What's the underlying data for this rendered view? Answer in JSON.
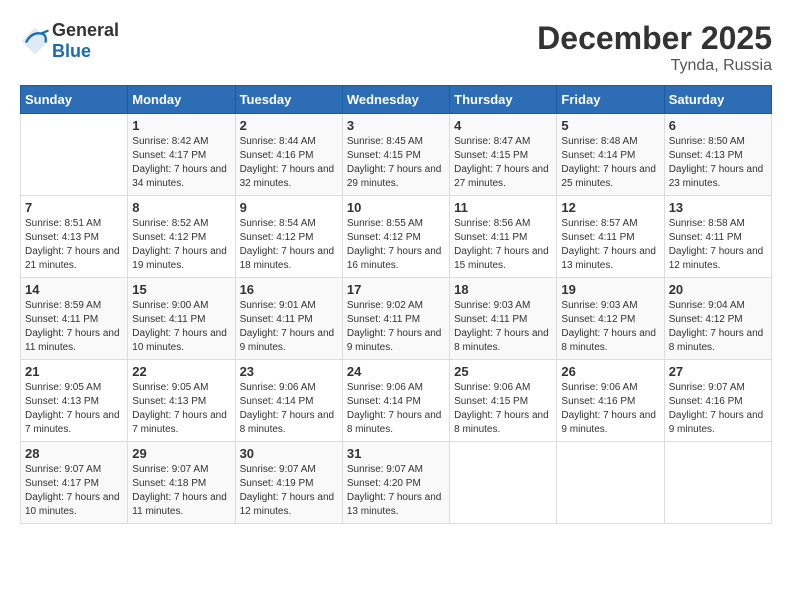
{
  "header": {
    "logo_general": "General",
    "logo_blue": "Blue",
    "month": "December 2025",
    "location": "Tynda, Russia"
  },
  "weekdays": [
    "Sunday",
    "Monday",
    "Tuesday",
    "Wednesday",
    "Thursday",
    "Friday",
    "Saturday"
  ],
  "weeks": [
    [
      {
        "day": "",
        "sunrise": "",
        "sunset": "",
        "daylight": ""
      },
      {
        "day": "1",
        "sunrise": "Sunrise: 8:42 AM",
        "sunset": "Sunset: 4:17 PM",
        "daylight": "Daylight: 7 hours and 34 minutes."
      },
      {
        "day": "2",
        "sunrise": "Sunrise: 8:44 AM",
        "sunset": "Sunset: 4:16 PM",
        "daylight": "Daylight: 7 hours and 32 minutes."
      },
      {
        "day": "3",
        "sunrise": "Sunrise: 8:45 AM",
        "sunset": "Sunset: 4:15 PM",
        "daylight": "Daylight: 7 hours and 29 minutes."
      },
      {
        "day": "4",
        "sunrise": "Sunrise: 8:47 AM",
        "sunset": "Sunset: 4:15 PM",
        "daylight": "Daylight: 7 hours and 27 minutes."
      },
      {
        "day": "5",
        "sunrise": "Sunrise: 8:48 AM",
        "sunset": "Sunset: 4:14 PM",
        "daylight": "Daylight: 7 hours and 25 minutes."
      },
      {
        "day": "6",
        "sunrise": "Sunrise: 8:50 AM",
        "sunset": "Sunset: 4:13 PM",
        "daylight": "Daylight: 7 hours and 23 minutes."
      }
    ],
    [
      {
        "day": "7",
        "sunrise": "Sunrise: 8:51 AM",
        "sunset": "Sunset: 4:13 PM",
        "daylight": "Daylight: 7 hours and 21 minutes."
      },
      {
        "day": "8",
        "sunrise": "Sunrise: 8:52 AM",
        "sunset": "Sunset: 4:12 PM",
        "daylight": "Daylight: 7 hours and 19 minutes."
      },
      {
        "day": "9",
        "sunrise": "Sunrise: 8:54 AM",
        "sunset": "Sunset: 4:12 PM",
        "daylight": "Daylight: 7 hours and 18 minutes."
      },
      {
        "day": "10",
        "sunrise": "Sunrise: 8:55 AM",
        "sunset": "Sunset: 4:12 PM",
        "daylight": "Daylight: 7 hours and 16 minutes."
      },
      {
        "day": "11",
        "sunrise": "Sunrise: 8:56 AM",
        "sunset": "Sunset: 4:11 PM",
        "daylight": "Daylight: 7 hours and 15 minutes."
      },
      {
        "day": "12",
        "sunrise": "Sunrise: 8:57 AM",
        "sunset": "Sunset: 4:11 PM",
        "daylight": "Daylight: 7 hours and 13 minutes."
      },
      {
        "day": "13",
        "sunrise": "Sunrise: 8:58 AM",
        "sunset": "Sunset: 4:11 PM",
        "daylight": "Daylight: 7 hours and 12 minutes."
      }
    ],
    [
      {
        "day": "14",
        "sunrise": "Sunrise: 8:59 AM",
        "sunset": "Sunset: 4:11 PM",
        "daylight": "Daylight: 7 hours and 11 minutes."
      },
      {
        "day": "15",
        "sunrise": "Sunrise: 9:00 AM",
        "sunset": "Sunset: 4:11 PM",
        "daylight": "Daylight: 7 hours and 10 minutes."
      },
      {
        "day": "16",
        "sunrise": "Sunrise: 9:01 AM",
        "sunset": "Sunset: 4:11 PM",
        "daylight": "Daylight: 7 hours and 9 minutes."
      },
      {
        "day": "17",
        "sunrise": "Sunrise: 9:02 AM",
        "sunset": "Sunset: 4:11 PM",
        "daylight": "Daylight: 7 hours and 9 minutes."
      },
      {
        "day": "18",
        "sunrise": "Sunrise: 9:03 AM",
        "sunset": "Sunset: 4:11 PM",
        "daylight": "Daylight: 7 hours and 8 minutes."
      },
      {
        "day": "19",
        "sunrise": "Sunrise: 9:03 AM",
        "sunset": "Sunset: 4:12 PM",
        "daylight": "Daylight: 7 hours and 8 minutes."
      },
      {
        "day": "20",
        "sunrise": "Sunrise: 9:04 AM",
        "sunset": "Sunset: 4:12 PM",
        "daylight": "Daylight: 7 hours and 8 minutes."
      }
    ],
    [
      {
        "day": "21",
        "sunrise": "Sunrise: 9:05 AM",
        "sunset": "Sunset: 4:13 PM",
        "daylight": "Daylight: 7 hours and 7 minutes."
      },
      {
        "day": "22",
        "sunrise": "Sunrise: 9:05 AM",
        "sunset": "Sunset: 4:13 PM",
        "daylight": "Daylight: 7 hours and 7 minutes."
      },
      {
        "day": "23",
        "sunrise": "Sunrise: 9:06 AM",
        "sunset": "Sunset: 4:14 PM",
        "daylight": "Daylight: 7 hours and 8 minutes."
      },
      {
        "day": "24",
        "sunrise": "Sunrise: 9:06 AM",
        "sunset": "Sunset: 4:14 PM",
        "daylight": "Daylight: 7 hours and 8 minutes."
      },
      {
        "day": "25",
        "sunrise": "Sunrise: 9:06 AM",
        "sunset": "Sunset: 4:15 PM",
        "daylight": "Daylight: 7 hours and 8 minutes."
      },
      {
        "day": "26",
        "sunrise": "Sunrise: 9:06 AM",
        "sunset": "Sunset: 4:16 PM",
        "daylight": "Daylight: 7 hours and 9 minutes."
      },
      {
        "day": "27",
        "sunrise": "Sunrise: 9:07 AM",
        "sunset": "Sunset: 4:16 PM",
        "daylight": "Daylight: 7 hours and 9 minutes."
      }
    ],
    [
      {
        "day": "28",
        "sunrise": "Sunrise: 9:07 AM",
        "sunset": "Sunset: 4:17 PM",
        "daylight": "Daylight: 7 hours and 10 minutes."
      },
      {
        "day": "29",
        "sunrise": "Sunrise: 9:07 AM",
        "sunset": "Sunset: 4:18 PM",
        "daylight": "Daylight: 7 hours and 11 minutes."
      },
      {
        "day": "30",
        "sunrise": "Sunrise: 9:07 AM",
        "sunset": "Sunset: 4:19 PM",
        "daylight": "Daylight: 7 hours and 12 minutes."
      },
      {
        "day": "31",
        "sunrise": "Sunrise: 9:07 AM",
        "sunset": "Sunset: 4:20 PM",
        "daylight": "Daylight: 7 hours and 13 minutes."
      },
      {
        "day": "",
        "sunrise": "",
        "sunset": "",
        "daylight": ""
      },
      {
        "day": "",
        "sunrise": "",
        "sunset": "",
        "daylight": ""
      },
      {
        "day": "",
        "sunrise": "",
        "sunset": "",
        "daylight": ""
      }
    ]
  ]
}
